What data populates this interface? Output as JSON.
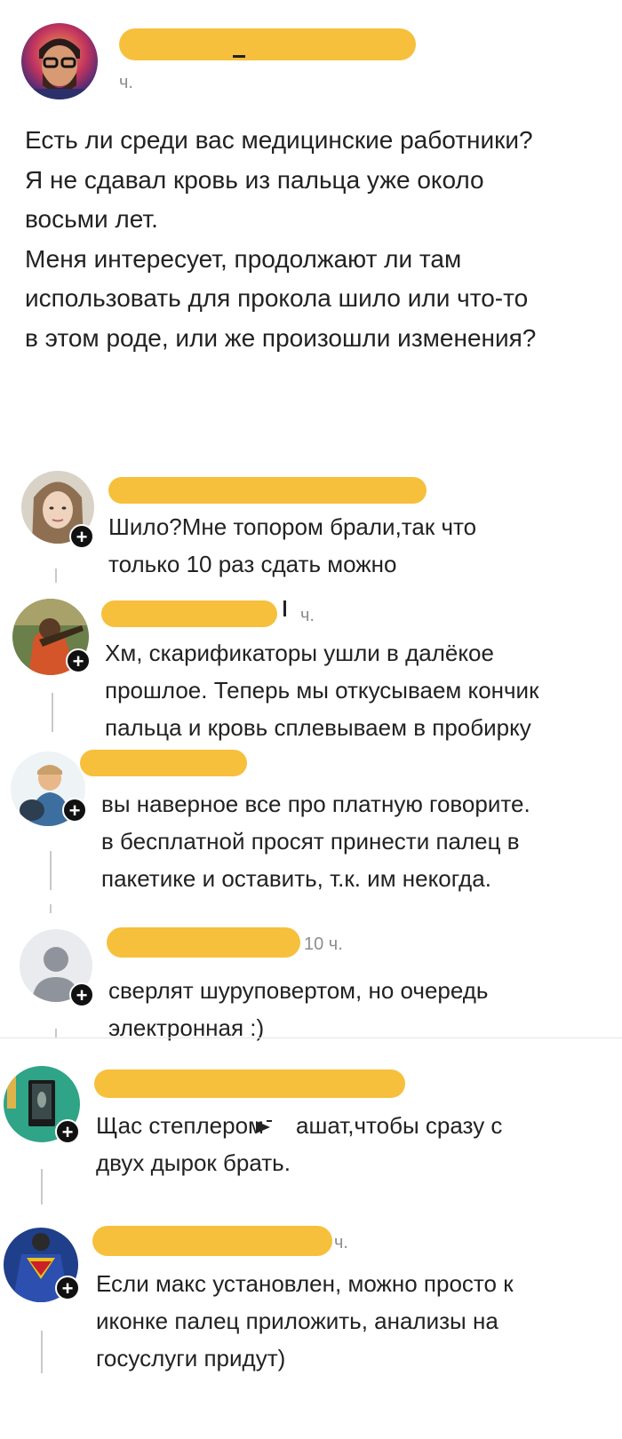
{
  "post": {
    "time_suffix": "ч.",
    "text": "Есть ли среди вас медицинские работники?\nЯ не сдавал кровь из пальца уже около\nвосьми лет.\nМеня интересует, продолжают ли там\nиспользовать для прокола шило или что-то\nв этом роде, или же произошли изменения?"
  },
  "comments": [
    {
      "text": "Шило?Мне топором брали,так что\nтолько 10 раз сдать можно",
      "time": ""
    },
    {
      "text": "Хм, скарификаторы ушли в далёкое\nпрошлое. Теперь мы откусываем кончик\nпальца и кровь сплевываем в пробирку",
      "time": "ч."
    },
    {
      "text": "вы наверное все про платную говорите.\nв бесплатной просят принести палец в\nпакетике и оставить, т.к. им некогда.",
      "time": ""
    },
    {
      "text": "сверлят шуруповертом, но очередь\nэлектронная :)",
      "time": "10 ч."
    },
    {
      "text": "Щас степлером     ашат,чтобы сразу с\nдвух дырок брать.",
      "time": ""
    },
    {
      "text": "Если макс  установлен, можно просто к\nиконке палец приложить, анализы на\nгосуслуги придут)",
      "time": "ч."
    }
  ],
  "colors": {
    "redaction": "#f6c03c",
    "text": "#222222",
    "muted": "#8e8e8e"
  }
}
